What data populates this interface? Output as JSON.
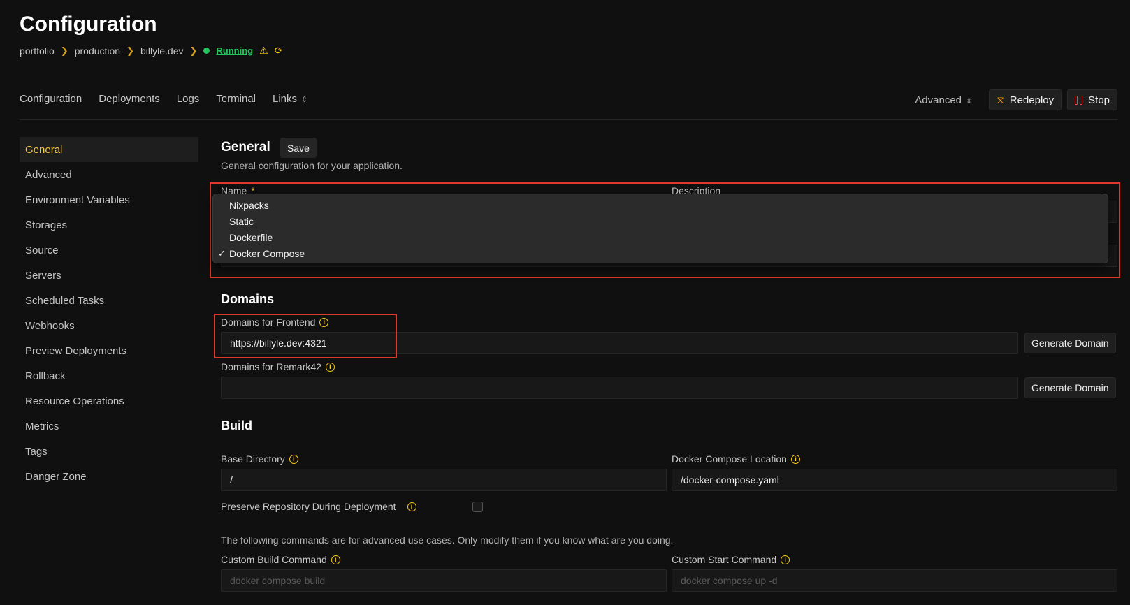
{
  "page": {
    "title": "Configuration"
  },
  "breadcrumb": {
    "items": [
      "portfolio",
      "production",
      "billyle.dev"
    ],
    "status": "Running"
  },
  "nav": {
    "tabs": [
      "Configuration",
      "Deployments",
      "Logs",
      "Terminal",
      "Links"
    ],
    "advanced": "Advanced",
    "redeploy": "Redeploy",
    "stop": "Stop"
  },
  "sidebar": {
    "items": [
      "General",
      "Advanced",
      "Environment Variables",
      "Storages",
      "Source",
      "Servers",
      "Scheduled Tasks",
      "Webhooks",
      "Preview Deployments",
      "Rollback",
      "Resource Operations",
      "Metrics",
      "Tags",
      "Danger Zone"
    ],
    "active": "General"
  },
  "general": {
    "title": "General",
    "save": "Save",
    "subtitle": "General configuration for your application.",
    "name_label": "Name",
    "required_mark": "*",
    "description_label": "Description"
  },
  "build_pack_dropdown": {
    "options": [
      "Nixpacks",
      "Static",
      "Dockerfile",
      "Docker Compose"
    ],
    "selected": "Docker Compose"
  },
  "domains": {
    "title": "Domains",
    "frontend_label": "Domains for Frontend",
    "frontend_value": "https://billyle.dev:4321",
    "remark_label": "Domains for Remark42",
    "remark_value": "",
    "generate": "Generate Domain"
  },
  "build": {
    "title": "Build",
    "base_dir_label": "Base Directory",
    "base_dir_value": "/",
    "compose_location_label": "Docker Compose Location",
    "compose_location_value": "/docker-compose.yaml",
    "preserve_label": "Preserve Repository During Deployment",
    "preserve_checked": false,
    "advanced_note": "The following commands are for advanced use cases. Only modify them if you know what are you doing.",
    "custom_build_label": "Custom Build Command",
    "custom_build_placeholder": "docker compose build",
    "custom_start_label": "Custom Start Command",
    "custom_start_placeholder": "docker compose up -d"
  },
  "colors": {
    "accent": "#f5c542",
    "status_ok": "#22c55e",
    "highlight": "#dc3a2a",
    "stop": "#ef4444"
  }
}
